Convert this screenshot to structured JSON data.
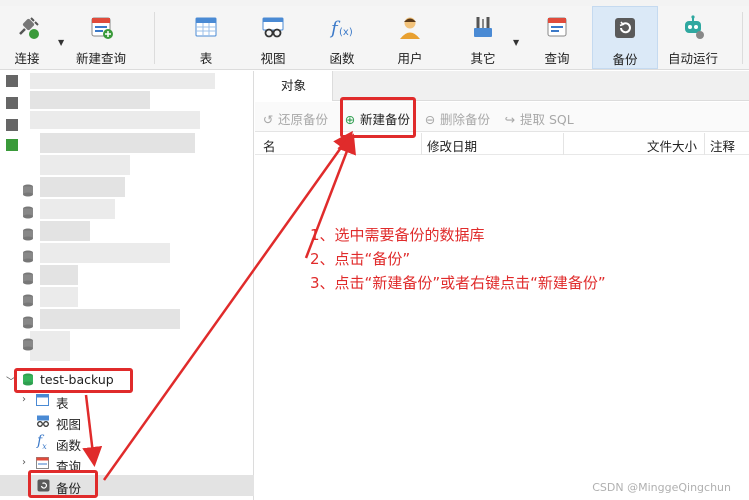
{
  "toolbar": {
    "connect": "连接",
    "new_query": "新建查询",
    "table": "表",
    "view": "视图",
    "function": "函数",
    "user": "用户",
    "other": "其它",
    "query": "查询",
    "backup": "备份",
    "automation": "自动运行"
  },
  "tree": {
    "database": "test-backup",
    "items": [
      {
        "label": "表"
      },
      {
        "label": "视图"
      },
      {
        "label": "函数"
      },
      {
        "label": "查询"
      },
      {
        "label": "备份"
      }
    ]
  },
  "main": {
    "tab": "对象",
    "actions": {
      "restore": "还原备份",
      "new": "新建备份",
      "delete": "删除备份",
      "extract": "提取 SQL"
    },
    "columns": {
      "name": "名",
      "modified": "修改日期",
      "size": "文件大小",
      "comment": "注释"
    }
  },
  "instructions": {
    "step1": "1、选中需要备份的数据库",
    "step2": "2、点击“备份”",
    "step3": "3、点击“新建备份”或者右键点击“新建备份”"
  },
  "watermark": "CSDN @MinggeQingchun",
  "colors": {
    "annotation_red": "#e02b2b",
    "active_tool_bg": "#dbe9f7",
    "db_green": "#2e9e4f"
  }
}
